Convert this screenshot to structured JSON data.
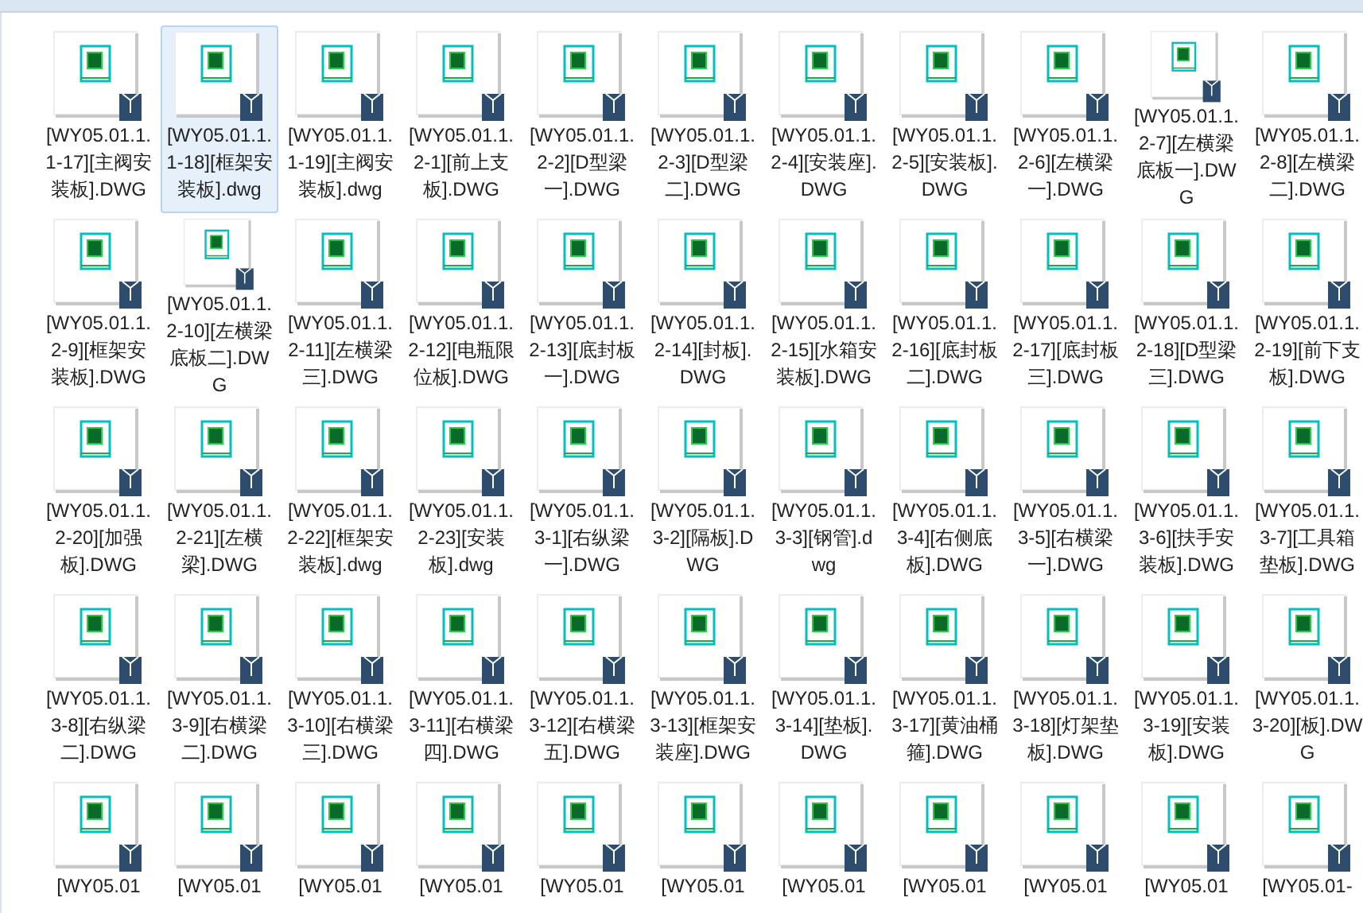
{
  "files": [
    {
      "label": "[WY05.01.1.1-17][主阀安装板].DWG",
      "selected": false
    },
    {
      "label": "[WY05.01.1.1-18][框架安装板].dwg",
      "selected": true
    },
    {
      "label": "[WY05.01.1.1-19][主阀安装板].dwg",
      "selected": false
    },
    {
      "label": "[WY05.01.1.2-1][前上支板].DWG",
      "selected": false
    },
    {
      "label": "[WY05.01.1.2-2][D型梁一].DWG",
      "selected": false
    },
    {
      "label": "[WY05.01.1.2-3][D型梁二].DWG",
      "selected": false
    },
    {
      "label": "[WY05.01.1.2-4][安装座].DWG",
      "selected": false
    },
    {
      "label": "[WY05.01.1.2-5][安装板].DWG",
      "selected": false
    },
    {
      "label": "[WY05.01.1.2-6][左横梁一].DWG",
      "selected": false
    },
    {
      "label": "[WY05.01.1.2-7][左横梁底板一].DWG",
      "selected": false
    },
    {
      "label": "[WY05.01.1.2-8][左横梁二].DWG",
      "selected": false
    },
    {
      "label": "[WY05.01.1.2-9][框架安装板].DWG",
      "selected": false
    },
    {
      "label": "[WY05.01.1.2-10][左横梁底板二].DWG",
      "selected": false
    },
    {
      "label": "[WY05.01.1.2-11][左横梁三].DWG",
      "selected": false
    },
    {
      "label": "[WY05.01.1.2-12][电瓶限位板].DWG",
      "selected": false
    },
    {
      "label": "[WY05.01.1.2-13][底封板一].DWG",
      "selected": false
    },
    {
      "label": "[WY05.01.1.2-14][封板].DWG",
      "selected": false
    },
    {
      "label": "[WY05.01.1.2-15][水箱安装板].DWG",
      "selected": false
    },
    {
      "label": "[WY05.01.1.2-16][底封板二].DWG",
      "selected": false
    },
    {
      "label": "[WY05.01.1.2-17][底封板三].DWG",
      "selected": false
    },
    {
      "label": "[WY05.01.1.2-18][D型梁三].DWG",
      "selected": false
    },
    {
      "label": "[WY05.01.1.2-19][前下支板].DWG",
      "selected": false
    },
    {
      "label": "[WY05.01.1.2-20][加强板].DWG",
      "selected": false
    },
    {
      "label": "[WY05.01.1.2-21][左横梁].DWG",
      "selected": false
    },
    {
      "label": "[WY05.01.1.2-22][框架安装板].dwg",
      "selected": false
    },
    {
      "label": "[WY05.01.1.2-23][安装板].dwg",
      "selected": false
    },
    {
      "label": "[WY05.01.1.3-1][右纵梁一].DWG",
      "selected": false
    },
    {
      "label": "[WY05.01.1.3-2][隔板].DWG",
      "selected": false
    },
    {
      "label": "[WY05.01.1.3-3][钢管].dwg",
      "selected": false
    },
    {
      "label": "[WY05.01.1.3-4][右侧底板].DWG",
      "selected": false
    },
    {
      "label": "[WY05.01.1.3-5][右横梁一].DWG",
      "selected": false
    },
    {
      "label": "[WY05.01.1.3-6][扶手安装板].DWG",
      "selected": false
    },
    {
      "label": "[WY05.01.1.3-7][工具箱垫板].DWG",
      "selected": false
    },
    {
      "label": "[WY05.01.1.3-8][右纵梁二].DWG",
      "selected": false
    },
    {
      "label": "[WY05.01.1.3-9][右横梁二].DWG",
      "selected": false
    },
    {
      "label": "[WY05.01.1.3-10][右横梁三].DWG",
      "selected": false
    },
    {
      "label": "[WY05.01.1.3-11][右横梁四].DWG",
      "selected": false
    },
    {
      "label": "[WY05.01.1.3-12][右横梁五].DWG",
      "selected": false
    },
    {
      "label": "[WY05.01.1.3-13][框架安装座].DWG",
      "selected": false
    },
    {
      "label": "[WY05.01.1.3-14][垫板].DWG",
      "selected": false
    },
    {
      "label": "[WY05.01.1.3-17][黄油桶箍].DWG",
      "selected": false
    },
    {
      "label": "[WY05.01.1.3-18][灯架垫板].DWG",
      "selected": false
    },
    {
      "label": "[WY05.01.1.3-19][安装板].DWG",
      "selected": false
    },
    {
      "label": "[WY05.01.1.3-20][板].DWG",
      "selected": false
    },
    {
      "label": "[WY05.01",
      "selected": false
    },
    {
      "label": "[WY05.01",
      "selected": false
    },
    {
      "label": "[WY05.01",
      "selected": false
    },
    {
      "label": "[WY05.01",
      "selected": false
    },
    {
      "label": "[WY05.01",
      "selected": false
    },
    {
      "label": "[WY05.01",
      "selected": false
    },
    {
      "label": "[WY05.01",
      "selected": false
    },
    {
      "label": "[WY05.01",
      "selected": false
    },
    {
      "label": "[WY05.01",
      "selected": false
    },
    {
      "label": "[WY05.01",
      "selected": false
    },
    {
      "label": "[WY05.01-",
      "selected": false
    }
  ]
}
